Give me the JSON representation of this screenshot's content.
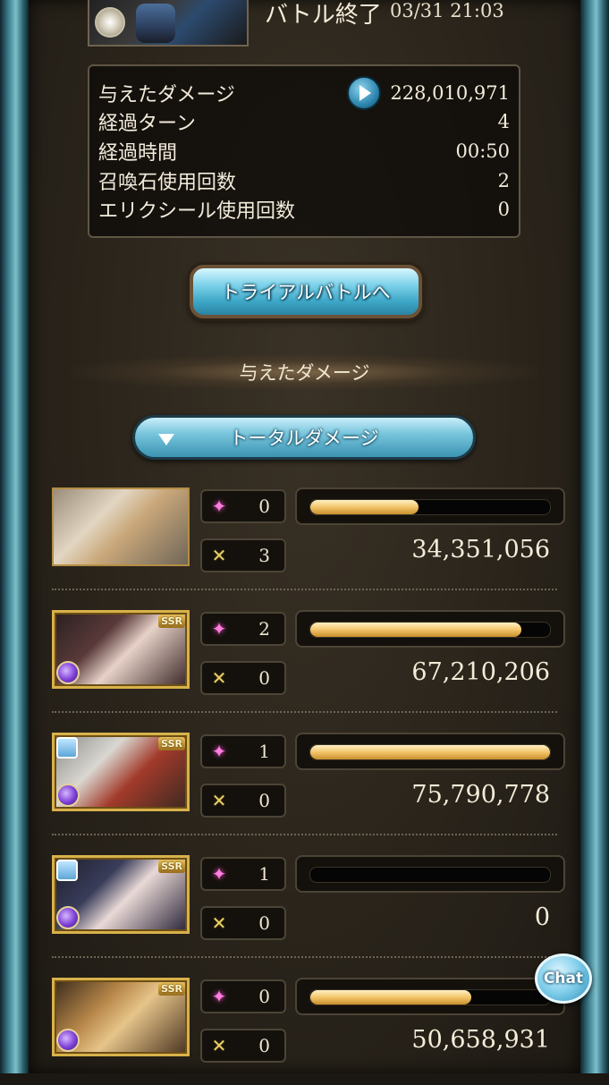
{
  "header": {
    "title": "バトル終了",
    "timestamp": "03/31 21:03"
  },
  "stats": {
    "rows": [
      {
        "label": "与えたダメージ",
        "value": "228,010,971"
      },
      {
        "label": "経過ターン",
        "value": "4"
      },
      {
        "label": "経過時間",
        "value": "00:50"
      },
      {
        "label": "召喚石使用回数",
        "value": "2"
      },
      {
        "label": "エリクシール使用回数",
        "value": "0"
      }
    ]
  },
  "trial_button_label": "トライアルバトルへ",
  "section_title": "与えたダメージ",
  "total_damage_button_label": "トータルダメージ",
  "characters": [
    {
      "rarity": "",
      "skills_used": "0",
      "attacks": "3",
      "damage": "34,351,056",
      "bar_fraction": 0.45
    },
    {
      "rarity": "SSR",
      "skills_used": "2",
      "attacks": "0",
      "damage": "67,210,206",
      "bar_fraction": 0.88
    },
    {
      "rarity": "SSR",
      "skills_used": "1",
      "attacks": "0",
      "damage": "75,790,778",
      "bar_fraction": 1.0
    },
    {
      "rarity": "SSR",
      "skills_used": "1",
      "attacks": "0",
      "damage": "0",
      "bar_fraction": 0.0
    },
    {
      "rarity": "SSR",
      "skills_used": "0",
      "attacks": "0",
      "damage": "50,658,931",
      "bar_fraction": 0.67
    }
  ],
  "chat_label": "Chat",
  "colors": {
    "bar_fill": "#f3c56a",
    "button_blue": "#3fa8c8",
    "skill_icon": "#ff7ee0",
    "attack_icon": "#ead16a"
  },
  "icons": {
    "skill": "sparkle-icon",
    "attack": "crossed-swords-icon",
    "play": "play-icon",
    "element": "dark-element-icon"
  }
}
